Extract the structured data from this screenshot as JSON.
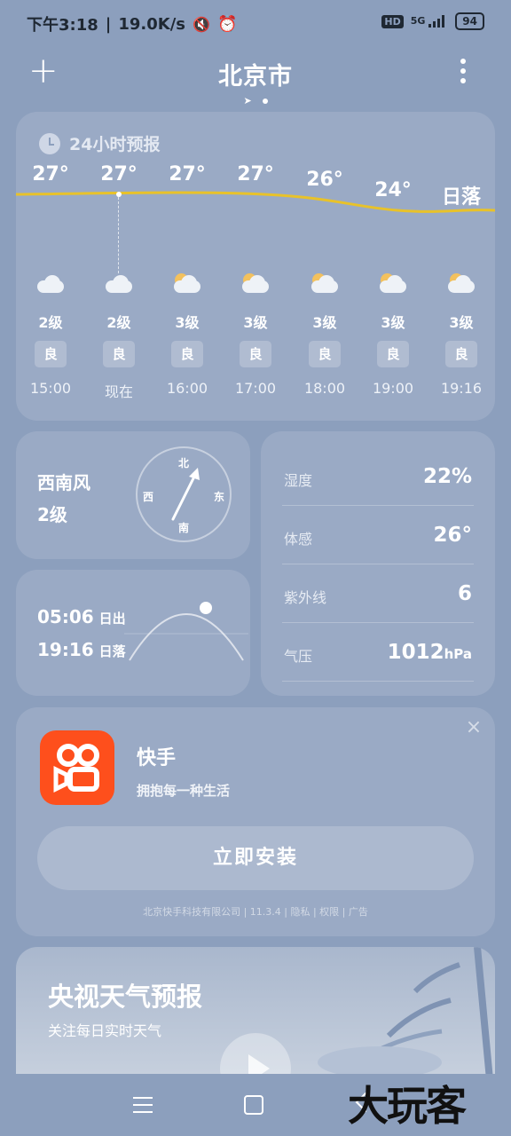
{
  "status_bar": {
    "time": "下午3:18",
    "speed": "19.0K/s",
    "network_badge": "HD",
    "signal_label": "5G",
    "battery": "94"
  },
  "header": {
    "city": "北京市"
  },
  "hourly": {
    "title": "24小时预报",
    "items": [
      {
        "temp": "27°",
        "icon": "cloud-icon",
        "wind": "2级",
        "aq": "良",
        "time": "15:00"
      },
      {
        "temp": "27°",
        "icon": "cloud-icon",
        "wind": "2级",
        "aq": "良",
        "time": "现在"
      },
      {
        "temp": "27°",
        "icon": "partly-cloudy-icon",
        "wind": "3级",
        "aq": "良",
        "time": "16:00"
      },
      {
        "temp": "27°",
        "icon": "partly-cloudy-icon",
        "wind": "3级",
        "aq": "良",
        "time": "17:00"
      },
      {
        "temp": "26°",
        "icon": "partly-cloudy-icon",
        "wind": "3级",
        "aq": "良",
        "time": "18:00"
      },
      {
        "temp": "24°",
        "icon": "partly-cloudy-icon",
        "wind": "3级",
        "aq": "良",
        "time": "19:00"
      },
      {
        "temp": "日落",
        "icon": "partly-cloudy-night-icon",
        "wind": "3级",
        "aq": "良",
        "time": "19:16"
      }
    ]
  },
  "wind": {
    "direction": "西南风",
    "level": "2级",
    "compass_n": "北",
    "compass_s": "南",
    "compass_e": "东",
    "compass_w": "西"
  },
  "sun": {
    "sunrise_time": "05:06",
    "sunrise_label": "日出",
    "sunset_time": "19:16",
    "sunset_label": "日落"
  },
  "details": [
    {
      "label": "湿度",
      "value": "22%",
      "unit": ""
    },
    {
      "label": "体感",
      "value": "26°",
      "unit": ""
    },
    {
      "label": "紫外线",
      "value": "6",
      "unit": ""
    },
    {
      "label": "气压",
      "value": "1012",
      "unit": "hPa"
    }
  ],
  "ad": {
    "app_name": "快手",
    "slogan": "拥抱每一种生活",
    "install_label": "立即安装",
    "footer": "北京快手科技有限公司 | 11.3.4 | 隐私 | 权限 | 广告",
    "brand_color": "#fe4f1c"
  },
  "video": {
    "title": "央视天气预报",
    "subtitle": "关注每日实时天气"
  },
  "watermark": "大玩客",
  "colors": {
    "background": "#8c9fbd",
    "temp_line": "#e8c22a",
    "sun_icon": "#f3c15d"
  }
}
